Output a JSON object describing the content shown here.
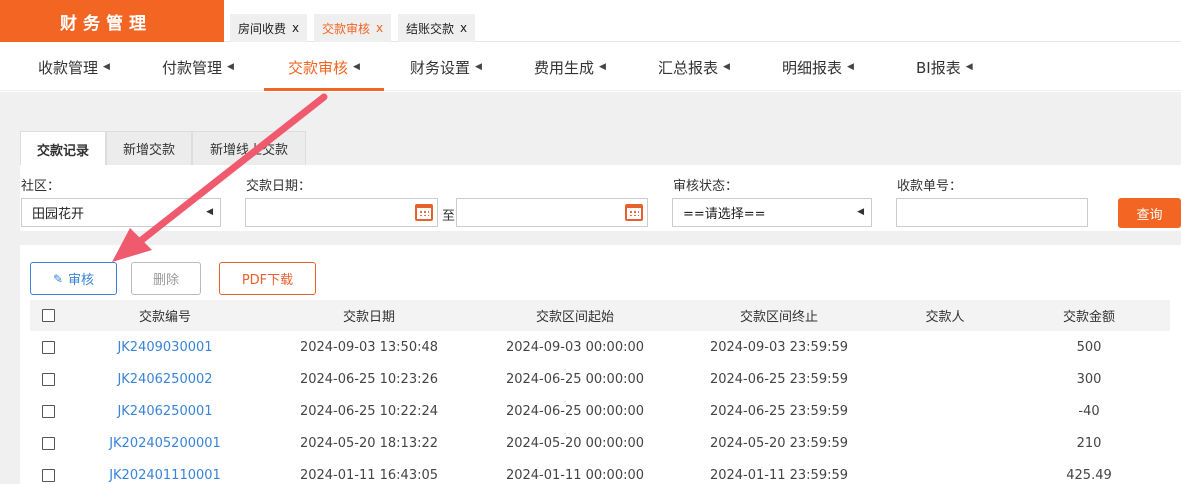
{
  "brand": "财务管理",
  "open_tabs": [
    {
      "label": "房间收费",
      "close": "x"
    },
    {
      "label": "交款审核",
      "close": "x"
    },
    {
      "label": "结账交款",
      "close": "x"
    }
  ],
  "modules": [
    {
      "label": "收款管理"
    },
    {
      "label": "付款管理"
    },
    {
      "label": "交款审核"
    },
    {
      "label": "财务设置"
    },
    {
      "label": "费用生成"
    },
    {
      "label": "汇总报表"
    },
    {
      "label": "明细报表"
    },
    {
      "label": "BI报表"
    }
  ],
  "subtabs": [
    {
      "label": "交款记录"
    },
    {
      "label": "新增交款"
    },
    {
      "label": "新增线上交款"
    }
  ],
  "filters": {
    "community_label": "社区：",
    "community_value": "田园花开",
    "date_label": "交款日期：",
    "date_to": "至",
    "status_label": "审核状态：",
    "status_value": "==请选择==",
    "receipt_label": "收款单号：",
    "query": "查询"
  },
  "actions": {
    "audit": "审核",
    "delete": "删除",
    "pdf": "PDF下载"
  },
  "table": {
    "headers": [
      "交款编号",
      "交款日期",
      "交款区间起始",
      "交款区间终止",
      "交款人",
      "交款金额"
    ],
    "rows": [
      [
        "JK2409030001",
        "2024-09-03 13:50:48",
        "2024-09-03 00:00:00",
        "2024-09-03 23:59:59",
        "",
        "500"
      ],
      [
        "JK2406250002",
        "2024-06-25 10:23:26",
        "2024-06-25 00:00:00",
        "2024-06-25 23:59:59",
        "",
        "300"
      ],
      [
        "JK2406250001",
        "2024-06-25 10:22:24",
        "2024-06-25 00:00:00",
        "2024-06-25 23:59:59",
        "",
        "-40"
      ],
      [
        "JK202405200001",
        "2024-05-20 18:13:22",
        "2024-05-20 00:00:00",
        "2024-05-20 23:59:59",
        "",
        "210"
      ],
      [
        "JK202401110001",
        "2024-01-11 16:43:05",
        "2024-01-11 00:00:00",
        "2024-01-11 23:59:59",
        "",
        "425.49"
      ]
    ]
  },
  "colors": {
    "accent": "#f26522",
    "link": "#3a83d8",
    "annotation": "#ef5a6e"
  }
}
